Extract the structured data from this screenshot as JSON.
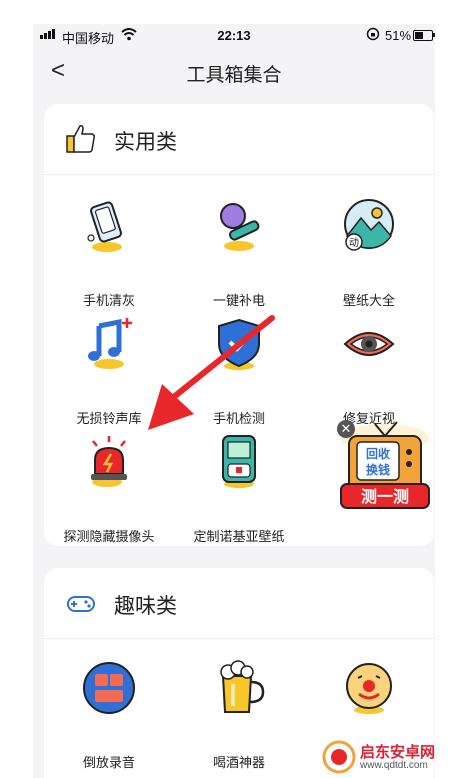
{
  "status_bar": {
    "carrier": "中国移动",
    "time": "22:13",
    "battery": "51%"
  },
  "nav": {
    "back_label": "<",
    "title": "工具箱集合"
  },
  "sections": [
    {
      "title": "实用类",
      "icon": "thumbs-up-icon",
      "items": [
        {
          "label": "手机清灰",
          "icon": "phone-clean-icon"
        },
        {
          "label": "一键补电",
          "icon": "charge-icon"
        },
        {
          "label": "壁纸大全",
          "icon": "wallpaper-icon",
          "badge": "动"
        },
        {
          "label": "无损铃声库",
          "icon": "music-note-icon"
        },
        {
          "label": "手机检测",
          "icon": "shield-check-icon"
        },
        {
          "label": "修复近视",
          "icon": "eye-icon"
        },
        {
          "label": "探测隐藏摄像头",
          "icon": "alarm-light-icon"
        },
        {
          "label": "定制诺基亚壁纸",
          "icon": "nokia-phone-icon"
        }
      ],
      "ad": {
        "line1": "回收",
        "line2": "换钱",
        "banner": "测一测",
        "close": "✕"
      }
    },
    {
      "title": "趣味类",
      "icon": "gamepad-icon",
      "items": [
        {
          "label": "倒放录音",
          "icon": "reverse-record-icon"
        },
        {
          "label": "喝酒神器",
          "icon": "beer-icon"
        },
        {
          "label": "",
          "icon": "clown-face-icon"
        }
      ]
    }
  ],
  "watermark": {
    "name": "启东安卓网",
    "url": "www.qdtdt.com"
  },
  "colors": {
    "accent_yellow": "#f7c52c",
    "annotation_red": "#e8272a",
    "icon_blue": "#2f6fd6"
  }
}
